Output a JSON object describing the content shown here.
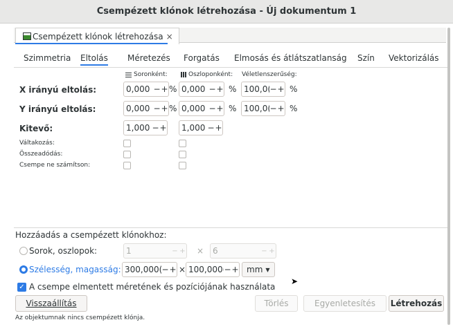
{
  "window": {
    "title": "Csempézett klónok létrehozása - Új dokumentum 1"
  },
  "doc_tab": {
    "label": "Csempézett klónok létrehozása",
    "close": "×"
  },
  "subtabs": [
    {
      "label": "Szimmetria"
    },
    {
      "label": "Eltolás",
      "active": true
    },
    {
      "label": "Méretezés"
    },
    {
      "label": "Forgatás"
    },
    {
      "label": "Elmosás és átlátszatlanság"
    },
    {
      "label": "Szín"
    },
    {
      "label": "Vektorizálás"
    }
  ],
  "columns": {
    "per_row": "Soronként:",
    "per_column": "Oszloponként:",
    "random": "Véletlenszerűség:"
  },
  "rows": {
    "x_shift": {
      "label": "X irányú eltolás:",
      "per_row": "0,000",
      "per_column": "0,000",
      "random": "100,0(",
      "unit": "%"
    },
    "y_shift": {
      "label": "Y irányú eltolás:",
      "per_row": "0,000",
      "per_column": "0,000",
      "random": "100,0(",
      "unit": "%"
    },
    "exponent": {
      "label": "Kitevő:",
      "per_row": "1,000",
      "per_column": "1,000"
    },
    "alternate": {
      "label": "Váltakozás:"
    },
    "cumulate": {
      "label": "Összeadódás:"
    },
    "exclude_tile": {
      "label": "Csempe ne számítson:"
    }
  },
  "spin_buttons": {
    "minus": "−",
    "plus": "+"
  },
  "tiling": {
    "section_label": "Hozzáadás a csempézett klónokhoz:",
    "rows_cols": {
      "label": "Sorok, oszlopok:",
      "rows": "1",
      "cols": "6",
      "selected": false
    },
    "width_height": {
      "label": "Szélesség, magasság:",
      "width": "300,000(",
      "height": "100,000(",
      "unit": "mm",
      "selected": true
    },
    "times": "×"
  },
  "use_saved": {
    "label": "A csempe elmentett méretének és pozíciójának használata",
    "checked": true
  },
  "buttons": {
    "reset": "Visszaállítás",
    "remove": "Törlés",
    "unclump": "Egyenletesítés",
    "create": "Létrehozás"
  },
  "status": "Az objektumnak nincs csempézett klónja."
}
